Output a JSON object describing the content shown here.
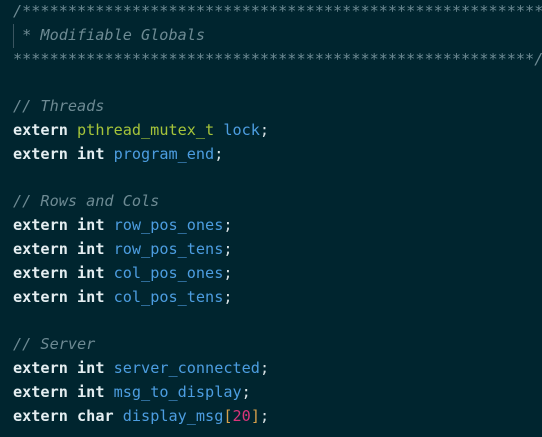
{
  "header": {
    "line1": "/*********************************************************",
    "line2": " * Modifiable Globals",
    "line3": "*********************************************************/"
  },
  "threads": {
    "comment": "// Threads",
    "lock": {
      "kw": "extern",
      "type": "pthread_mutex_t",
      "name": "lock",
      "end": ";"
    },
    "program_end": {
      "kw": "extern",
      "type": "int",
      "name": "program_end",
      "end": ";"
    }
  },
  "rows_cols": {
    "comment": "// Rows and Cols",
    "decls": [
      {
        "kw": "extern",
        "type": "int",
        "name": "row_pos_ones",
        "end": ";"
      },
      {
        "kw": "extern",
        "type": "int",
        "name": "row_pos_tens",
        "end": ";"
      },
      {
        "kw": "extern",
        "type": "int",
        "name": "col_pos_ones",
        "end": ";"
      },
      {
        "kw": "extern",
        "type": "int",
        "name": "col_pos_tens",
        "end": ";"
      }
    ]
  },
  "server": {
    "comment": "// Server",
    "decls": [
      {
        "kw": "extern",
        "type": "int",
        "name": "server_connected",
        "end": ";"
      },
      {
        "kw": "extern",
        "type": "int",
        "name": "msg_to_display",
        "end": ";"
      }
    ],
    "display_msg": {
      "kw": "extern",
      "type": "char",
      "name": "display_msg",
      "open": "[",
      "size": "20",
      "close": "]",
      "end": ";"
    }
  }
}
